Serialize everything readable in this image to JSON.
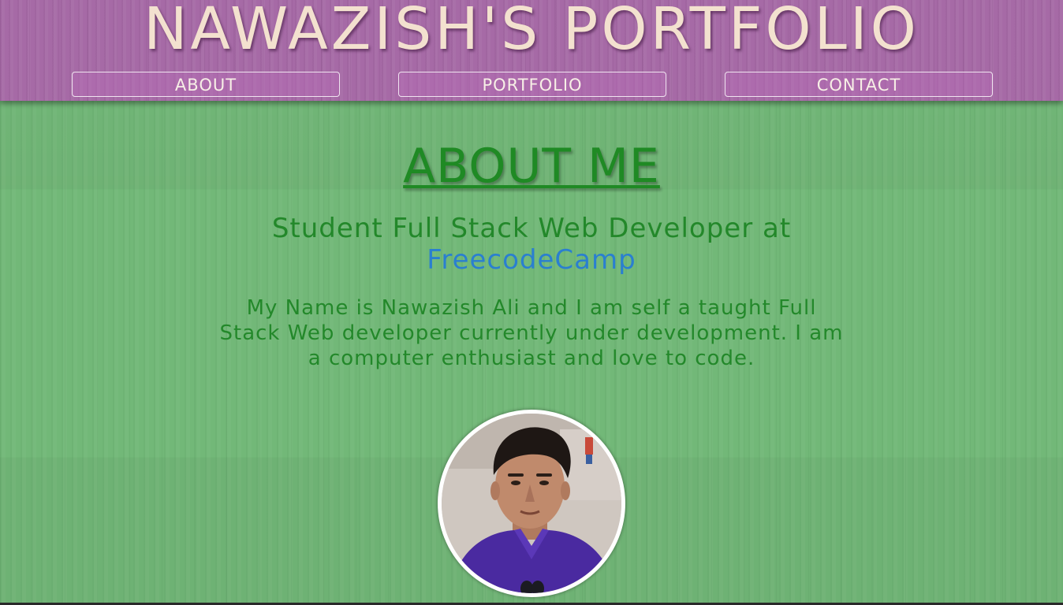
{
  "header": {
    "title": "NAWAZISH'S PORTFOLIO",
    "nav": [
      {
        "label": "ABOUT"
      },
      {
        "label": "PORTFOLIO"
      },
      {
        "label": "CONTACT"
      }
    ]
  },
  "about": {
    "heading": "ABOUT ME",
    "subtitle_text": "Student Full Stack Web Developer at",
    "subtitle_link": "FreecodeCamp",
    "bio": "My Name is Nawazish Ali and I am self a taught Full Stack Web developer currently under development. I am a computer enthusiast and love to code."
  },
  "colors": {
    "header_bg": "#a66aa6",
    "page_bg": "#72b878",
    "heading_green": "#1f8a24",
    "link_blue": "#2a7fd0",
    "title_cream": "#f3e1cf"
  }
}
